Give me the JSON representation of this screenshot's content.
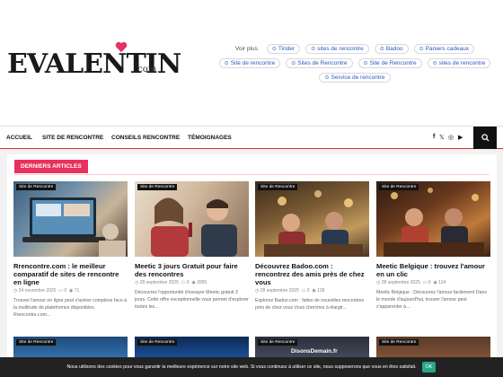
{
  "logo": {
    "brand": "EVALENTIN",
    "tld": ".com"
  },
  "tags": {
    "voir_plus": "Voir plus",
    "rows": [
      [
        "Tinder",
        "sites de rencontre",
        "Badoo",
        "Paniers cadeaux"
      ],
      [
        "Site de rencontre",
        "Sites de Rencontre",
        "Site de Rencontre",
        "sites de rencontre"
      ],
      [
        "Service de rencontre"
      ]
    ]
  },
  "nav": {
    "items": [
      "ACCUEIL",
      "SITE DE RENCONTRE",
      "CONSEILS RENCONTRE",
      "TÉMOIGNAGES"
    ],
    "social": [
      "f",
      "𝕏",
      "◎",
      "▶"
    ]
  },
  "section": {
    "label": "DERNIERS ARTICLES"
  },
  "cards": [
    {
      "badge": "Site de Rencontre",
      "title": "Rrencontre.com : le meilleur comparatif de sites de rencontre en ligne",
      "date": "24 novembre 2025",
      "comments": "0",
      "views": "71",
      "excerpt": "Trouver l'amour en ligne peut s'avérer complexe face à la multitude de plateformes disponibles. Rrencontre.com..."
    },
    {
      "badge": "Site de Rencontre",
      "title": "Meetic 3 jours Gratuit pour faire des rencontres",
      "date": "28 septembre 2025",
      "comments": "0",
      "views": "3955",
      "excerpt": "Découvrez l'opportunité d'essayer Meetic gratuit 3 jours. Cette offre exceptionnelle vous permet d'explorer toutes les..."
    },
    {
      "badge": "Site de Rencontre",
      "title": "Découvrez Badoo.com : rencontrez des amis près de chez vous",
      "date": "28 septembre 2025",
      "comments": "0",
      "views": "128",
      "excerpt": "Explorez Badoo.com : faites de nouvelles rencontres près de chez vous Vous cherchez à élargir..."
    },
    {
      "badge": "Site de Rencontre",
      "title": "Meetic Belgique : trouvez l'amour en un clic",
      "date": "28 septembre 2025",
      "comments": "0",
      "views": "134",
      "excerpt": "Meetic Belgique : Découvrez l'amour facilement Dans le monde d'aujourd'hui, trouver l'amour peut s'apparenter à..."
    }
  ],
  "row2_badges": [
    "Site de Rencontre",
    "Site de Rencontre",
    "Site de Rencontre",
    "Site de Rencontre"
  ],
  "row2_overlay": "DisonsDemain.fr",
  "cookie": {
    "text": "Nous utilisons des cookies pour vous garantir la meilleure expérience sur notre site web. Si vous continuez à utiliser ce site, nous supposerons que vous en êtes satisfait.",
    "ok": "OK"
  },
  "colors": {
    "accent": "#e8315c",
    "link": "#2a5bbf",
    "cookie_ok": "#2aa58a"
  }
}
